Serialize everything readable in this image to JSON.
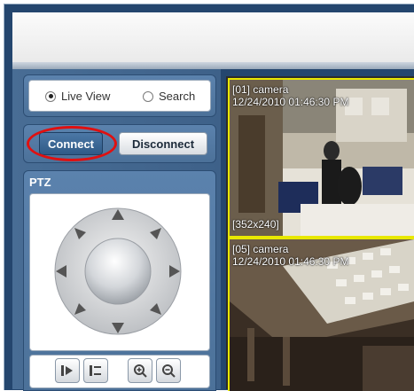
{
  "view_mode": {
    "options": [
      {
        "label": "Live View",
        "selected": true
      },
      {
        "label": "Search",
        "selected": false
      }
    ]
  },
  "connection": {
    "connect_label": "Connect",
    "disconnect_label": "Disconnect",
    "highlight_color": "#e01010"
  },
  "ptz": {
    "title": "PTZ",
    "directions": [
      "up",
      "up-right",
      "right",
      "down-right",
      "down",
      "down-left",
      "left",
      "up-left"
    ],
    "tools": [
      "focus-near-icon",
      "focus-far-icon",
      "zoom-in-icon",
      "zoom-out-icon"
    ]
  },
  "cameras": [
    {
      "name": "[01] camera",
      "timestamp": "12/24/2010 01:46:30 PM",
      "resolution": "[352x240]"
    },
    {
      "name": "[05] camera",
      "timestamp": "12/24/2010 01:46:30 PM"
    }
  ]
}
